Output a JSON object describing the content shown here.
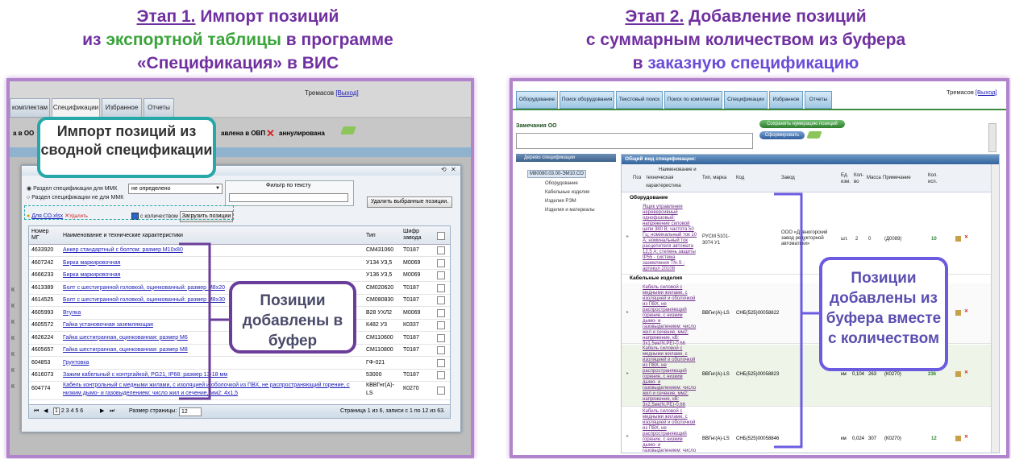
{
  "left_title": {
    "l1a": "Этап 1.",
    "l1b": " Импорт позиций",
    "l2a": "из ",
    "l2b": "экспортной таблицы",
    "l2c": " в программе",
    "l3": "«Спецификация» в ВИС"
  },
  "right_title": {
    "l1a": "Этап 2.",
    "l1b": " Добавление позиций",
    "l2": "с суммарным количеством из буфера",
    "l3a": "в ",
    "l3b": "заказную спецификацию"
  },
  "left": {
    "user": "Тремасов",
    "exit": "[Выход]",
    "tabs": [
      "комплектам",
      "Спецификации",
      "Избранное",
      "Отчеты"
    ],
    "behind_left": "а в ОО",
    "behind_mid": "авлена в ОВП",
    "behind_ann": "аннулирована",
    "radio1": "Раздел спецификации для ММК",
    "radio2": "Раздел спецификации не для ММК",
    "select_value": "не определено",
    "filter_label": "Фильтр по тексту",
    "delete_btn": "Удалить выбранные позиции.",
    "file_name": "Для СО.xlsx",
    "file_delete": "Удалить",
    "qty_check": "с количеством",
    "load_btn": "Загрузить позиции",
    "col_num": "Номер МГ",
    "col_name": "Наименование и технические характеристики",
    "col_type": "Тип",
    "col_code": "Шифр завода",
    "rows": [
      {
        "n": "4633920",
        "name": "Анкер стандартный с болтом: размер М10х80",
        "type": "СМ431060",
        "code": "Т0187"
      },
      {
        "n": "4607242",
        "name": "Бирка маркировочная",
        "type": "У134 У3,5",
        "code": "М0069"
      },
      {
        "n": "4666233",
        "name": "Бирка маркировочная",
        "type": "У136 У3,5",
        "code": "М0069"
      },
      {
        "n": "4613389",
        "name": "Болт с шестигранной головкой, оцинкованный: размер М8х20",
        "type": "СМ020620",
        "code": "Т0187"
      },
      {
        "n": "4614525",
        "name": "Болт с шестигранной головкой, оцинкованный: размер М8х30",
        "type": "СМ080830",
        "code": "Т0187"
      },
      {
        "n": "4605993",
        "name": "Втулка",
        "type": "В28 УХЛ2",
        "code": "М0069"
      },
      {
        "n": "4605572",
        "name": "Гайка установочная заземляющая",
        "type": "К482 У3",
        "code": "К0337"
      },
      {
        "n": "4626224",
        "name": "Гайка шестигранная, оцинкованная: размер М6",
        "type": "СМ110600",
        "code": "Т0187"
      },
      {
        "n": "4605657",
        "name": "Гайка шестигранная, оцинкованная: размер М8",
        "type": "СМ110800",
        "code": "Т0187"
      },
      {
        "n": "604853",
        "name": "Грунтовка",
        "type": "ГФ-021",
        "code": ""
      },
      {
        "n": "4616073",
        "name": "Зажим кабельный с контргайкой, PG21, IP68: размер 13-18 мм",
        "type": "53000",
        "code": "Т0187"
      },
      {
        "n": "604774",
        "name": "Кабель контрольный с медными жилами, с изоляцией и оболочкой из ПВХ, не распространяющий горение, с",
        "name2": "низким дымо- и газовыделением: число жил и сечение, мм2: 4х1,5",
        "type": "КВВГнг(А)-LS",
        "code": "К0270"
      }
    ],
    "pager_pages": [
      "1",
      "2",
      "3",
      "4",
      "5",
      "6"
    ],
    "page_size_label": "Размер страницы:",
    "page_size": "12",
    "pager_info": "Страница 1 из 6, записи с 1 по 12 из 63.",
    "callout_import": "Импорт позиций из сводной спецификации",
    "callout_buffer": "Позиции добавлены в буфер"
  },
  "right": {
    "user": "Тремасов",
    "exit": "[Выход]",
    "tabs": [
      "Оборудование",
      "Поиск оборудования",
      "Текстовый поиск",
      "Поиск по комплектам",
      "Спецификации",
      "Избранное",
      "Отчеты"
    ],
    "remarks_label": "Замечания ОО",
    "save_btn": "Сохранить нумерацию позиций",
    "form_btn": "Сформировать",
    "tree_header": "Дерево спецификации",
    "tree_root": "М80080.03.00-ЭМ10.СО",
    "tree_items": [
      "Оборудование",
      "Кабельные изделия",
      "Изделия РЭМ",
      "Изделия и материалы"
    ],
    "view_header": "Общий вид спецификации:",
    "col_name_top": "Наименование и",
    "col_pos": "Поз",
    "col_tech": "техническая",
    "col_char": "характеристика",
    "col_type": "Тип, марка",
    "col_code": "Код",
    "col_plant": "Завод",
    "col_unit": "Ед. изм.",
    "col_qty": "Кол-во",
    "col_mass": "Масса",
    "col_note": "Примечание",
    "col_qty2": "Кол. исп.",
    "group1": "Оборудование",
    "group2": "Кабельные изделия",
    "item1": {
      "desc": "Ящик управления нереверсивный однофазовый: напряжение силовой цепи 380 В; частота 50 Гц; номинальный ток 10 А; номинальный ток расцепителя автомата 12,5 А; степень защиты IP55 - система заземления TN-S ; артикул 20108",
      "type": "РУСМ 5101-3074 У1",
      "plant": "ООО «Дивногорский завод редукторной автоматики»",
      "unit": "шт.",
      "qty": "2",
      "mass": "0",
      "note": "(Д0089)",
      "use": "10"
    },
    "item2": {
      "desc": "Кабель силовой с медными жилами, с изоляцией и оболочкой из ПВХ, не распространяющий горение, с низким дымо- и газовыделением: число жил и сечение, мм2; напряжение, кВ: 3х1,5мк(N,PE)-0,66",
      "type": "ВВГнг(А)-LS",
      "code": "СНБ(525)00058822"
    },
    "item3": {
      "desc": "Кабель силовой с медными жилами, с изоляцией и оболочкой из ПВХ, не распространяющий горение, с низким дымо- и газовыделением: число жил и сечение, мм2; напряжение, кВ: 3х2,5мк(N,PE)-0,66",
      "type": "ВВГнг(А)-LS",
      "code": "СНБ(525)00058823",
      "unit": "км",
      "qty": "0,104",
      "mass": "263",
      "note": "(К0270)",
      "use": "236"
    },
    "item4": {
      "desc": "Кабель силовой с медными жилами, с изоляцией и оболочкой из ПВХ, не распространяющий горение, с низким дымо- и газовыделением: число",
      "type": "ВВГнг(А)-LS",
      "code": "СНБ(525)00058846",
      "unit": "км",
      "qty": "0,024",
      "mass": "307",
      "note": "(К0270)",
      "use": "12"
    },
    "callout": "Позиции добавлены из буфера вместе с количеством"
  },
  "colors": {
    "title": "#7030a0",
    "green": "#3aa43a",
    "blue": "#6a4dd8",
    "panel_border": "#b184cc",
    "teal": "#27a8a8",
    "callout_purple": "#6a3d9a",
    "callout_blue": "#6b5be0"
  }
}
